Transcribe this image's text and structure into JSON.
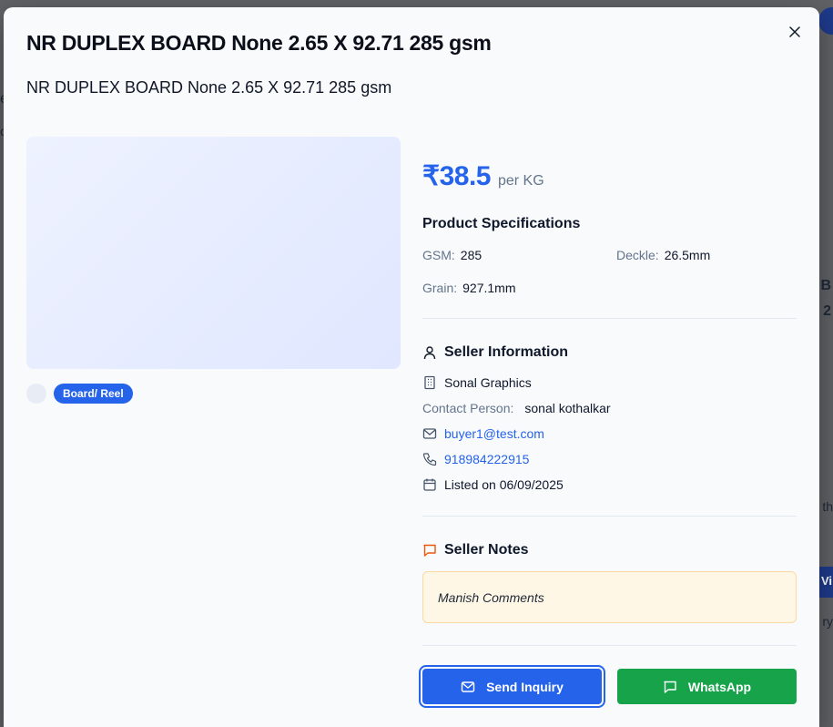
{
  "modal": {
    "title": "NR DUPLEX BOARD None 2.65 X 92.71 285 gsm",
    "subtitle": "NR DUPLEX BOARD None 2.65 X 92.71 285 gsm",
    "close_icon": "close-icon",
    "category_tag": "Board/ Reel"
  },
  "price": {
    "amount": "₹38.5",
    "unit": "per KG",
    "color": "#2563eb"
  },
  "specifications": {
    "title": "Product Specifications",
    "items": [
      {
        "label": "GSM:",
        "value": "285"
      },
      {
        "label": "Deckle:",
        "value": "26.5mm"
      },
      {
        "label": "Grain:",
        "value": "927.1mm"
      }
    ]
  },
  "seller": {
    "title": "Seller Information",
    "company": "Sonal Graphics",
    "contact_label": "Contact Person:",
    "contact_name": "sonal kothalkar",
    "email": "buyer1@test.com",
    "phone": "918984222915",
    "listed": "Listed on 06/09/2025"
  },
  "notes": {
    "title": "Seller Notes",
    "text": "Manish Comments"
  },
  "actions": {
    "inquiry_label": "Send Inquiry",
    "whatsapp_label": "WhatsApp",
    "inquiry_color": "#2563eb",
    "whatsapp_color": "#16a34a"
  },
  "background": {
    "fragments": [
      "B",
      "2",
      "th",
      "ry",
      "Vi",
      "e",
      "c"
    ]
  }
}
